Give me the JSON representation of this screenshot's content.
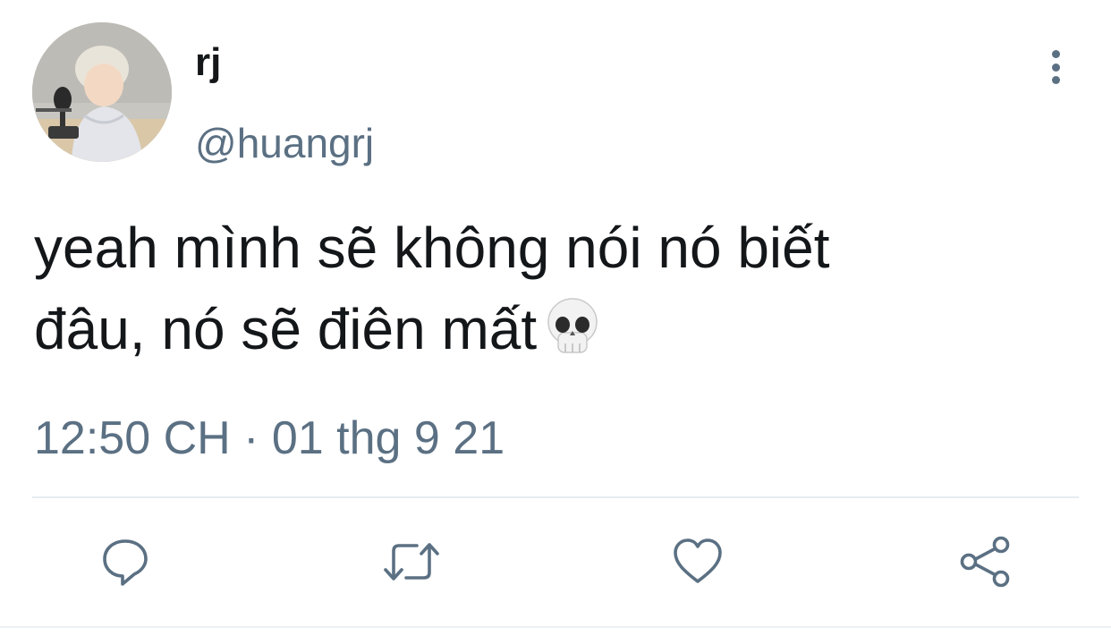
{
  "tweet": {
    "display_name": "rj",
    "handle": "@huangrj",
    "text_line_1": "yeah mình sẽ không nói nó biết",
    "text_line_2": "đâu, nó sẽ điên mất",
    "emoji": "skull-emoji",
    "timestamp": "12:50 CH · 01 thg 9 21"
  },
  "actions": {
    "reply_icon": "speech-bubble-icon",
    "retweet_icon": "retweet-arrows-icon",
    "like_icon": "heart-icon",
    "share_icon": "share-nodes-icon"
  },
  "colors": {
    "text": "#14171a",
    "secondary": "#5b7083",
    "divider": "#e6ecf0"
  }
}
